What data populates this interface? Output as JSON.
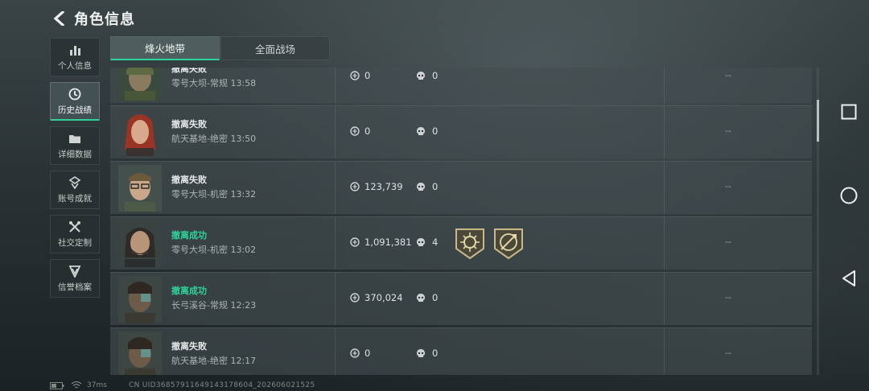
{
  "header": {
    "title": "角色信息",
    "back_icon": "chevron-left-icon"
  },
  "sidebar": {
    "items": [
      {
        "label": "个人信息",
        "icon": "bar-chart-icon",
        "active": false
      },
      {
        "label": "历史战绩",
        "icon": "clock-icon",
        "active": true
      },
      {
        "label": "详细数据",
        "icon": "folder-icon",
        "active": false
      },
      {
        "label": "账号成就",
        "icon": "medal-icon",
        "active": false
      },
      {
        "label": "社交定制",
        "icon": "tools-icon",
        "active": false
      },
      {
        "label": "信誉档案",
        "icon": "shield-icon",
        "active": false
      }
    ]
  },
  "tabs": [
    {
      "label": "烽火地带",
      "active": true
    },
    {
      "label": "全面战场",
      "active": false
    }
  ],
  "records": [
    {
      "result": "撤离失败",
      "success": false,
      "map": "零号大坝-常规 13:58",
      "money": "0",
      "kills": "0",
      "extra": "--",
      "badges": []
    },
    {
      "result": "撤离失败",
      "success": false,
      "map": "航天基地-绝密 13:50",
      "money": "0",
      "kills": "0",
      "extra": "--",
      "badges": []
    },
    {
      "result": "撤离失败",
      "success": false,
      "map": "零号大坝-机密 13:32",
      "money": "123,739",
      "kills": "0",
      "extra": "--",
      "badges": []
    },
    {
      "result": "撤离成功",
      "success": true,
      "map": "零号大坝-机密 13:02",
      "money": "1,091,381",
      "kills": "4",
      "extra": "--",
      "badges": [
        "sun-emblem-badge-icon",
        "sword-emblem-badge-icon"
      ]
    },
    {
      "result": "撤离成功",
      "success": true,
      "map": "长弓溪谷-常规 12:23",
      "money": "370,024",
      "kills": "0",
      "extra": "--",
      "badges": []
    },
    {
      "result": "撤离失败",
      "success": false,
      "map": "航天基地-绝密 12:17",
      "money": "0",
      "kills": "0",
      "extra": "--",
      "badges": []
    }
  ],
  "footer": {
    "ping": "37ms",
    "uid": "CN UID368579116491431786​04_202606021525"
  },
  "colors": {
    "accent": "#2fd39a",
    "panel": "#444e50"
  }
}
